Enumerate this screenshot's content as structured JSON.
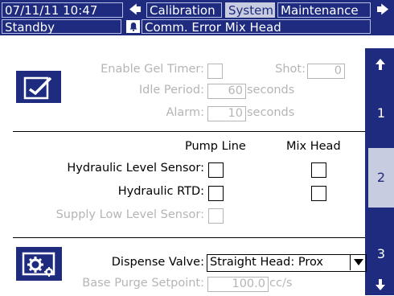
{
  "header": {
    "datetime": "07/11/11 10:47",
    "tabs": [
      {
        "label": "Calibration"
      },
      {
        "label": "System",
        "selected": true
      },
      {
        "label": "Maintenance"
      }
    ],
    "status": "Standby",
    "error_message": "Comm. Error Mix Head"
  },
  "side_tabs": [
    {
      "label": "1"
    },
    {
      "label": "2",
      "active": true
    },
    {
      "label": "3"
    }
  ],
  "gel_section": {
    "enable_gel_timer_label": "Enable Gel Timer:",
    "shot_label": "Shot:",
    "shot_value": "0",
    "idle_period_label": "Idle Period:",
    "idle_period_value": "60",
    "idle_period_unit": "seconds",
    "alarm_label": "Alarm:",
    "alarm_value": "10",
    "alarm_unit": "seconds"
  },
  "sensor_section": {
    "col_pump_line": "Pump Line",
    "col_mix_head": "Mix Head",
    "hydraulic_level_label": "Hydraulic Level Sensor:",
    "hydraulic_rtd_label": "Hydraulic RTD:",
    "supply_low_label": "Supply Low Level Sensor:"
  },
  "valve_section": {
    "dispense_valve_label": "Dispense Valve:",
    "dispense_valve_value": "Straight Head: Prox",
    "base_purge_label": "Base Purge Setpoint:",
    "base_purge_value": "100.0",
    "base_purge_unit": "cc/s"
  },
  "colors": {
    "primary": "#1e2b7e",
    "selected_tab": "#c8cce0",
    "disabled_text": "#b5b5b5"
  }
}
